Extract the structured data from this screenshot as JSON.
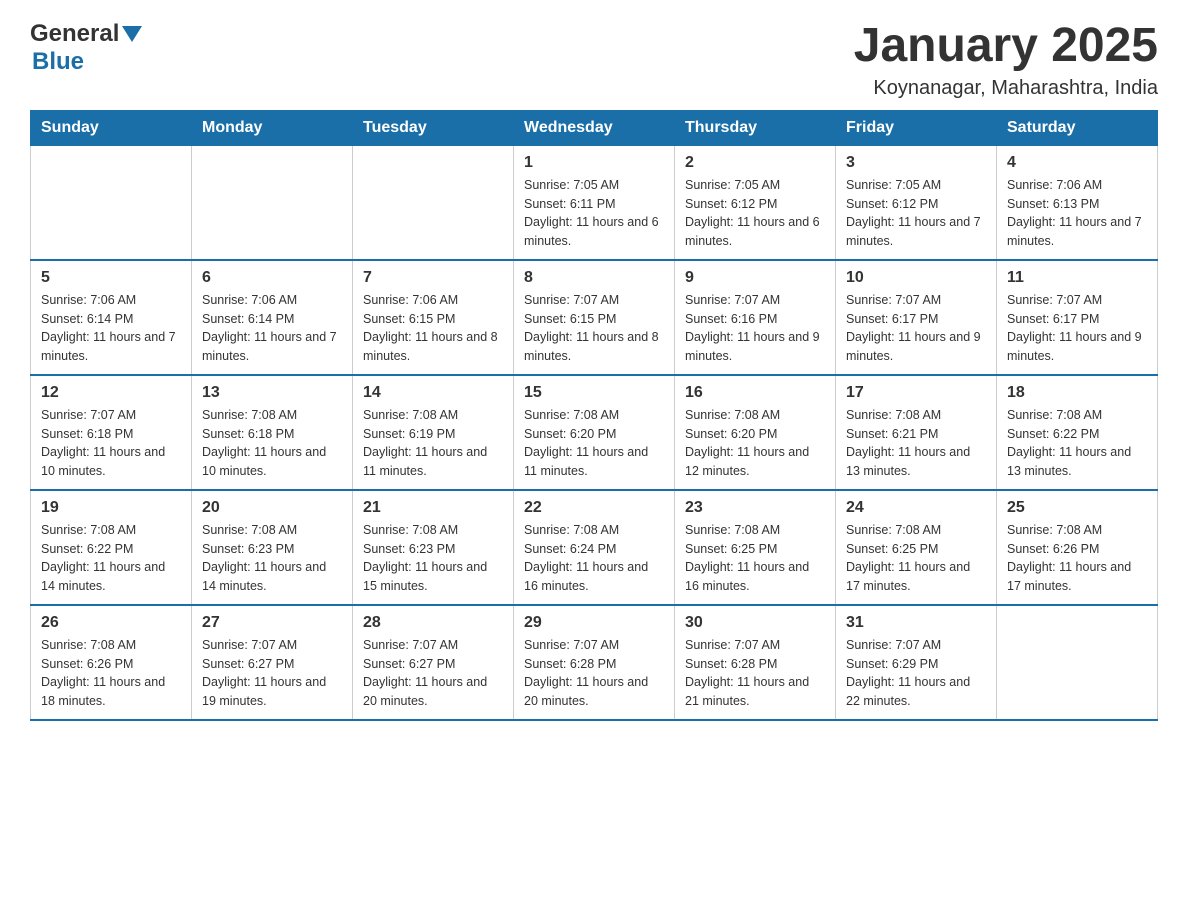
{
  "header": {
    "logo_general": "General",
    "logo_blue": "Blue",
    "title": "January 2025",
    "subtitle": "Koynanagar, Maharashtra, India"
  },
  "calendar": {
    "days_of_week": [
      "Sunday",
      "Monday",
      "Tuesday",
      "Wednesday",
      "Thursday",
      "Friday",
      "Saturday"
    ],
    "weeks": [
      [
        {
          "day": "",
          "info": ""
        },
        {
          "day": "",
          "info": ""
        },
        {
          "day": "",
          "info": ""
        },
        {
          "day": "1",
          "info": "Sunrise: 7:05 AM\nSunset: 6:11 PM\nDaylight: 11 hours and 6 minutes."
        },
        {
          "day": "2",
          "info": "Sunrise: 7:05 AM\nSunset: 6:12 PM\nDaylight: 11 hours and 6 minutes."
        },
        {
          "day": "3",
          "info": "Sunrise: 7:05 AM\nSunset: 6:12 PM\nDaylight: 11 hours and 7 minutes."
        },
        {
          "day": "4",
          "info": "Sunrise: 7:06 AM\nSunset: 6:13 PM\nDaylight: 11 hours and 7 minutes."
        }
      ],
      [
        {
          "day": "5",
          "info": "Sunrise: 7:06 AM\nSunset: 6:14 PM\nDaylight: 11 hours and 7 minutes."
        },
        {
          "day": "6",
          "info": "Sunrise: 7:06 AM\nSunset: 6:14 PM\nDaylight: 11 hours and 7 minutes."
        },
        {
          "day": "7",
          "info": "Sunrise: 7:06 AM\nSunset: 6:15 PM\nDaylight: 11 hours and 8 minutes."
        },
        {
          "day": "8",
          "info": "Sunrise: 7:07 AM\nSunset: 6:15 PM\nDaylight: 11 hours and 8 minutes."
        },
        {
          "day": "9",
          "info": "Sunrise: 7:07 AM\nSunset: 6:16 PM\nDaylight: 11 hours and 9 minutes."
        },
        {
          "day": "10",
          "info": "Sunrise: 7:07 AM\nSunset: 6:17 PM\nDaylight: 11 hours and 9 minutes."
        },
        {
          "day": "11",
          "info": "Sunrise: 7:07 AM\nSunset: 6:17 PM\nDaylight: 11 hours and 9 minutes."
        }
      ],
      [
        {
          "day": "12",
          "info": "Sunrise: 7:07 AM\nSunset: 6:18 PM\nDaylight: 11 hours and 10 minutes."
        },
        {
          "day": "13",
          "info": "Sunrise: 7:08 AM\nSunset: 6:18 PM\nDaylight: 11 hours and 10 minutes."
        },
        {
          "day": "14",
          "info": "Sunrise: 7:08 AM\nSunset: 6:19 PM\nDaylight: 11 hours and 11 minutes."
        },
        {
          "day": "15",
          "info": "Sunrise: 7:08 AM\nSunset: 6:20 PM\nDaylight: 11 hours and 11 minutes."
        },
        {
          "day": "16",
          "info": "Sunrise: 7:08 AM\nSunset: 6:20 PM\nDaylight: 11 hours and 12 minutes."
        },
        {
          "day": "17",
          "info": "Sunrise: 7:08 AM\nSunset: 6:21 PM\nDaylight: 11 hours and 13 minutes."
        },
        {
          "day": "18",
          "info": "Sunrise: 7:08 AM\nSunset: 6:22 PM\nDaylight: 11 hours and 13 minutes."
        }
      ],
      [
        {
          "day": "19",
          "info": "Sunrise: 7:08 AM\nSunset: 6:22 PM\nDaylight: 11 hours and 14 minutes."
        },
        {
          "day": "20",
          "info": "Sunrise: 7:08 AM\nSunset: 6:23 PM\nDaylight: 11 hours and 14 minutes."
        },
        {
          "day": "21",
          "info": "Sunrise: 7:08 AM\nSunset: 6:23 PM\nDaylight: 11 hours and 15 minutes."
        },
        {
          "day": "22",
          "info": "Sunrise: 7:08 AM\nSunset: 6:24 PM\nDaylight: 11 hours and 16 minutes."
        },
        {
          "day": "23",
          "info": "Sunrise: 7:08 AM\nSunset: 6:25 PM\nDaylight: 11 hours and 16 minutes."
        },
        {
          "day": "24",
          "info": "Sunrise: 7:08 AM\nSunset: 6:25 PM\nDaylight: 11 hours and 17 minutes."
        },
        {
          "day": "25",
          "info": "Sunrise: 7:08 AM\nSunset: 6:26 PM\nDaylight: 11 hours and 17 minutes."
        }
      ],
      [
        {
          "day": "26",
          "info": "Sunrise: 7:08 AM\nSunset: 6:26 PM\nDaylight: 11 hours and 18 minutes."
        },
        {
          "day": "27",
          "info": "Sunrise: 7:07 AM\nSunset: 6:27 PM\nDaylight: 11 hours and 19 minutes."
        },
        {
          "day": "28",
          "info": "Sunrise: 7:07 AM\nSunset: 6:27 PM\nDaylight: 11 hours and 20 minutes."
        },
        {
          "day": "29",
          "info": "Sunrise: 7:07 AM\nSunset: 6:28 PM\nDaylight: 11 hours and 20 minutes."
        },
        {
          "day": "30",
          "info": "Sunrise: 7:07 AM\nSunset: 6:28 PM\nDaylight: 11 hours and 21 minutes."
        },
        {
          "day": "31",
          "info": "Sunrise: 7:07 AM\nSunset: 6:29 PM\nDaylight: 11 hours and 22 minutes."
        },
        {
          "day": "",
          "info": ""
        }
      ]
    ]
  }
}
